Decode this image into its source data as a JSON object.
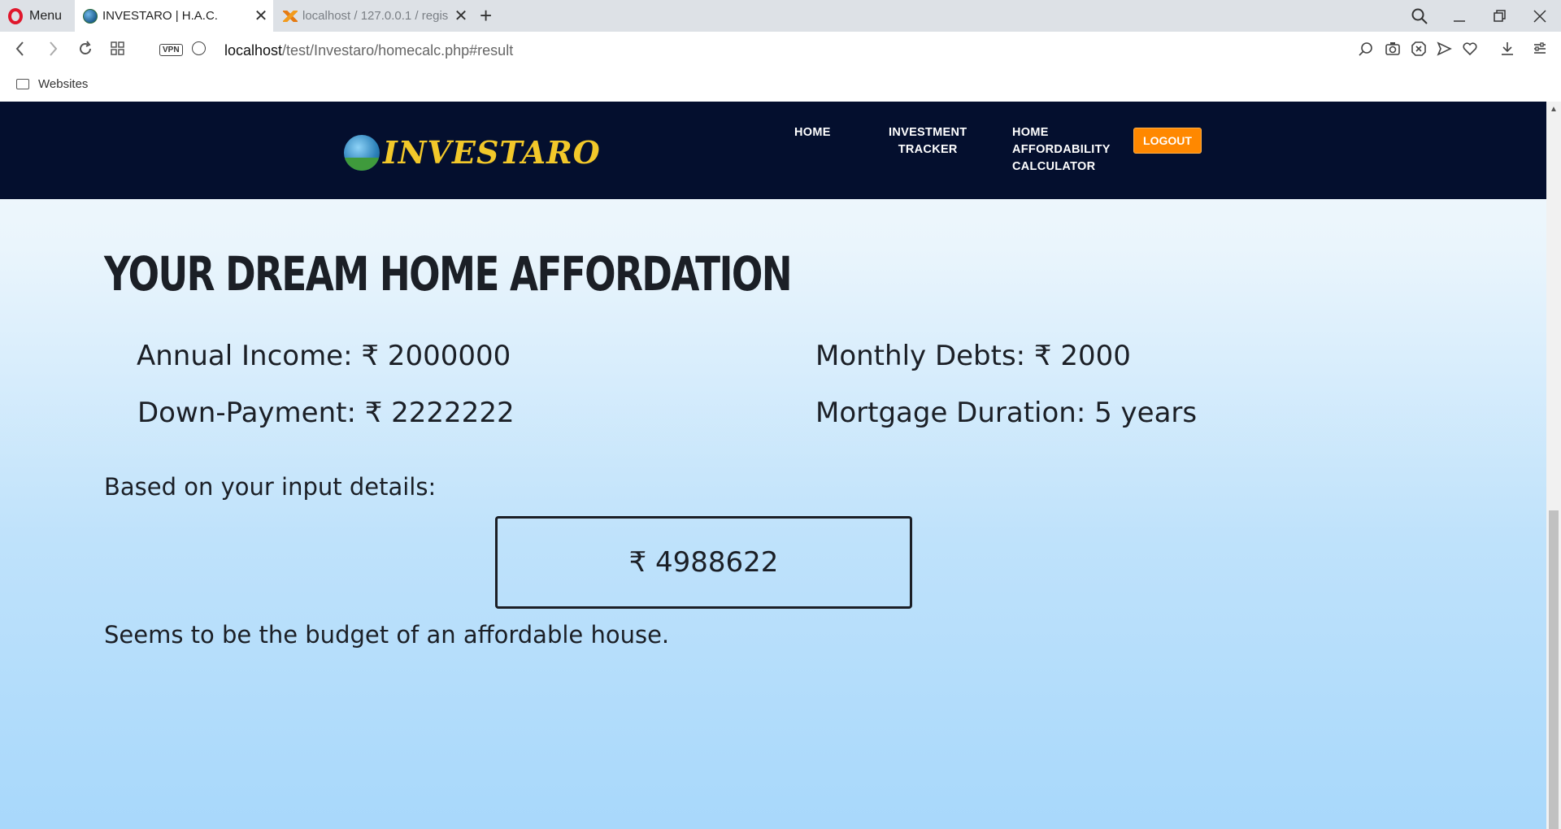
{
  "browser": {
    "menu_label": "Menu",
    "tabs": [
      {
        "title": "INVESTARO | H.A.C.",
        "active": true
      },
      {
        "title": "localhost / 127.0.0.1 / regis",
        "active": false
      }
    ],
    "url_host": "localhost",
    "url_path": "/test/Investaro/homecalc.php#result",
    "vpn_label": "VPN",
    "bookmarks": [
      {
        "label": "Websites"
      }
    ]
  },
  "site": {
    "brand": "INVESTARO",
    "nav": {
      "home": "HOME",
      "investment_line1": "INVESTMENT",
      "investment_line2": "TRACKER",
      "hac_line1": "HOME",
      "hac_line2": "AFFORDABILITY",
      "hac_line3": "CALCULATOR",
      "logout": "LOGOUT"
    }
  },
  "main": {
    "heading": "YOUR DREAM HOME AFFORDATION",
    "annual_income": "Annual Income: ₹ 2000000",
    "monthly_debts": "Monthly Debts: ₹ 2000",
    "down_payment": "Down-Payment: ₹ 2222222",
    "mortgage_duration": "Mortgage Duration: 5 years",
    "based_on": "Based on your input details:",
    "result": "₹ 4988622",
    "conclusion": "Seems to be the budget of an affordable house."
  },
  "colors": {
    "header_bg": "#040f2e",
    "logo_text": "#f2c82a",
    "logout_bg": "#ff8800",
    "opera_red": "#e0172c"
  }
}
